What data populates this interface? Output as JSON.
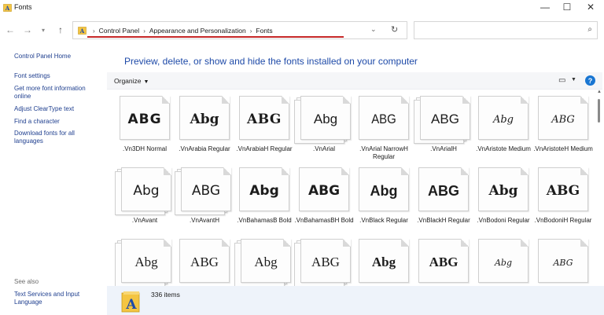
{
  "window": {
    "title": "Fonts",
    "controls": {
      "minimize": "—",
      "maximize": "☐",
      "close": "✕"
    }
  },
  "nav": {
    "back_icon": "arrow-left-icon",
    "forward_icon": "arrow-right-icon",
    "recent_icon": "chevron-down-icon",
    "up_icon": "arrow-up-icon",
    "breadcrumb": [
      "Control Panel",
      "Appearance and Personalization",
      "Fonts"
    ],
    "search_placeholder": ""
  },
  "sidebar": {
    "home": "Control Panel Home",
    "links": [
      "Font settings",
      "Get more font information online",
      "Adjust ClearType text",
      "Find a character",
      "Download fonts for all languages"
    ],
    "see_also_label": "See also",
    "see_also_links": [
      "Text Services and Input Language"
    ]
  },
  "main": {
    "heading": "Preview, delete, or show and hide the fonts installed on your computer",
    "organize_label": "Organize",
    "help_label": "?"
  },
  "fonts": [
    {
      "sample": "ABG",
      "name": ".Vn3DH Normal",
      "stacked": false,
      "style": "s-3dh"
    },
    {
      "sample": "Abg",
      "name": ".VnArabia Regular",
      "stacked": false,
      "style": "s-arabia"
    },
    {
      "sample": "ABG",
      "name": ".VnArabiaH Regular",
      "stacked": false,
      "style": "s-arabiah"
    },
    {
      "sample": "Abg",
      "name": ".VnArial",
      "stacked": true,
      "style": "s-arial"
    },
    {
      "sample": "ABG",
      "name": ".VnArial NarrowH Regular",
      "stacked": false,
      "style": "s-arialnarrow"
    },
    {
      "sample": "ABG",
      "name": ".VnArialH",
      "stacked": true,
      "style": "s-arialh"
    },
    {
      "sample": "Abg",
      "name": ".VnAristote Medium",
      "stacked": false,
      "style": "s-aristote"
    },
    {
      "sample": "ABG",
      "name": ".VnAristoteH Medium",
      "stacked": false,
      "style": "s-aristoteh"
    },
    {
      "sample": "Abg",
      "name": ".VnAvant",
      "stacked": true,
      "style": "s-avant"
    },
    {
      "sample": "ABG",
      "name": ".VnAvantH",
      "stacked": true,
      "style": "s-avanth"
    },
    {
      "sample": "Abg",
      "name": ".VnBahamasB Bold",
      "stacked": false,
      "style": "s-bahamasb"
    },
    {
      "sample": "ABG",
      "name": ".VnBahamasBH Bold",
      "stacked": false,
      "style": "s-bahamasbh"
    },
    {
      "sample": "Abg",
      "name": ".VnBlack Regular",
      "stacked": false,
      "style": "s-black"
    },
    {
      "sample": "ABG",
      "name": ".VnBlackH Regular",
      "stacked": false,
      "style": "s-blackh"
    },
    {
      "sample": "Abg",
      "name": ".VnBodoni Regular",
      "stacked": false,
      "style": "s-bodoni"
    },
    {
      "sample": "ABG",
      "name": ".VnBodoniH Regular",
      "stacked": false,
      "style": "s-bodonih"
    },
    {
      "sample": "Abg",
      "name": "",
      "stacked": true,
      "style": "s-r3a"
    },
    {
      "sample": "ABG",
      "name": "",
      "stacked": false,
      "style": "s-r3b"
    },
    {
      "sample": "Abg",
      "name": "",
      "stacked": true,
      "style": "s-r3c"
    },
    {
      "sample": "ABG",
      "name": "",
      "stacked": true,
      "style": "s-r3d"
    },
    {
      "sample": "Abg",
      "name": "",
      "stacked": false,
      "style": "s-r3e"
    },
    {
      "sample": "ABG",
      "name": "",
      "stacked": false,
      "style": "s-r3f"
    },
    {
      "sample": "Abg",
      "name": "",
      "stacked": false,
      "style": "s-r3g"
    },
    {
      "sample": "ABG",
      "name": "",
      "stacked": false,
      "style": "s-r3h"
    }
  ],
  "status": {
    "item_count": "336 items"
  },
  "colors": {
    "heading": "#1e4aa8",
    "link": "#1f3f8f",
    "breadcrumb_underline": "#c62828",
    "details_bg": "#eef3fa",
    "help": "#1976d2"
  }
}
